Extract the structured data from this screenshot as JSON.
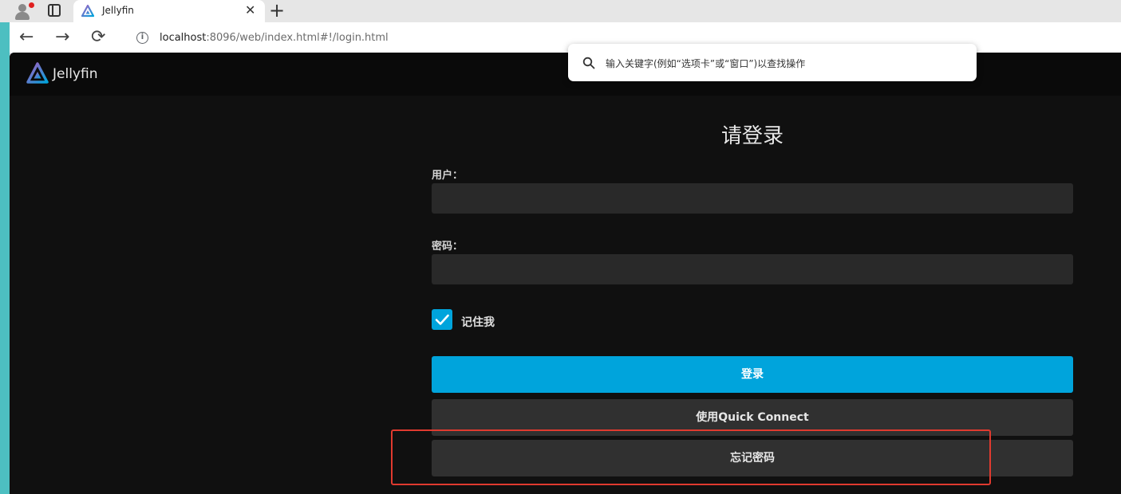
{
  "browser": {
    "tab": {
      "title": "Jellyfin",
      "close_glyph": "✕"
    },
    "new_tab_glyph": "+",
    "nav": {
      "back": "←",
      "forward": "→",
      "reload": "⟳"
    },
    "url": {
      "host": "localhost",
      "rest": ":8096/web/index.html#!/login.html"
    }
  },
  "palette": {
    "placeholder": "输入关键字(例如“选项卡”或“窗口”)以查找操作"
  },
  "app": {
    "brand": "Jellyfin",
    "login": {
      "title": "请登录",
      "user_label": "用户：",
      "user_value": "",
      "password_label": "密码：",
      "password_value": "",
      "remember_label": "记住我",
      "remember_checked": true,
      "login_button": "登录",
      "quick_connect_button": "使用Quick Connect",
      "forgot_button": "忘记密码"
    }
  },
  "colors": {
    "accent": "#00a4dc",
    "app_bg": "#101010",
    "input_bg": "#292929",
    "secondary_button": "#303030",
    "highlight_box": "#e03a2f"
  }
}
